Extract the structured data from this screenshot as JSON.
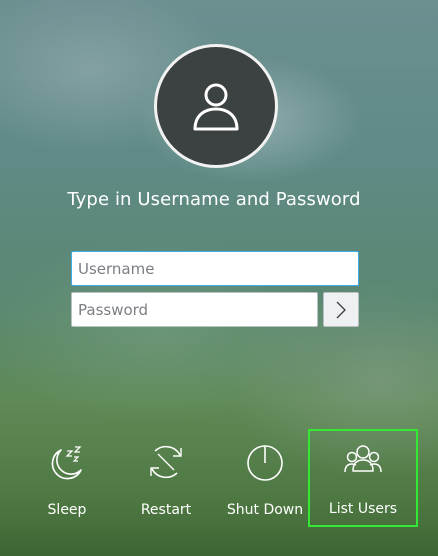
{
  "login": {
    "prompt": "Type in Username and Password",
    "username_placeholder": "Username",
    "password_placeholder": "Password"
  },
  "actions": [
    {
      "label": "Sleep",
      "icon": "sleep-icon"
    },
    {
      "label": "Restart",
      "icon": "restart-icon"
    },
    {
      "label": "Shut Down",
      "icon": "shutdown-icon"
    },
    {
      "label": "List Users",
      "icon": "users-icon",
      "selected": true
    }
  ],
  "colors": {
    "focus": "#3daee9",
    "selection_highlight": "#34e834",
    "avatar_bg": "#3c4141"
  }
}
